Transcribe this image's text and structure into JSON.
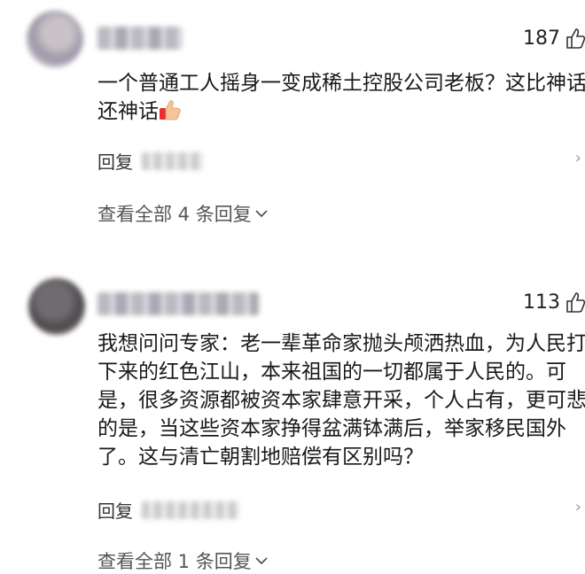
{
  "comments": [
    {
      "likes": "187",
      "text": "一个普通工人摇身一变成稀土控股公司老板？这比神话\n还神话",
      "emoji": "thumbs-up",
      "reply_label": "回复",
      "view_replies": "查看全部 4 条回复"
    },
    {
      "likes": "113",
      "text": "我想问问专家：老一辈革命家抛头颅洒热血，为人民打\n下来的红色江山，本来祖国的一切都属于人民的。可\n是，很多资源都被资本家肆意开采，个人占有，更可悲\n的是，当这些资本家挣得盆满钵满后，举家移民国外\n了。这与清亡朝割地赔偿有区别吗？",
      "reply_label": "回复",
      "view_replies": "查看全部 1 条回复"
    }
  ],
  "icons": {
    "like": "thumbs-up-outline-icon",
    "chevron": "chevron-down-icon",
    "more": "more-icon"
  }
}
